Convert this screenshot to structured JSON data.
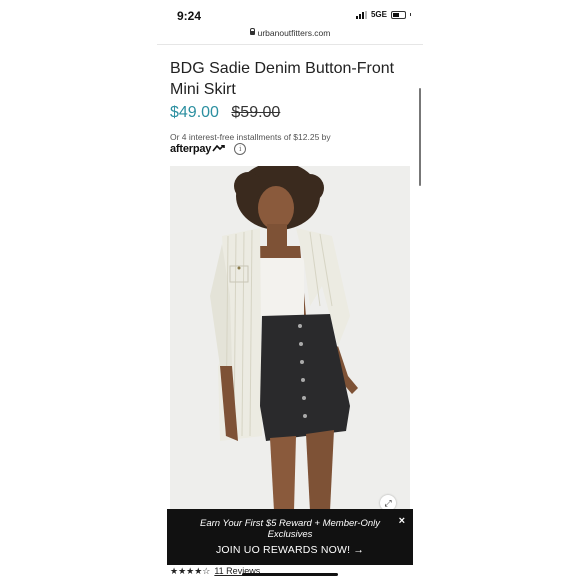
{
  "status_bar": {
    "time": "9:24",
    "network": "5GE"
  },
  "browser": {
    "url": "urbanoutfitters.com"
  },
  "product": {
    "title": "BDG Sadie Denim Button-Front Mini Skirt",
    "sale_price": "$49.00",
    "original_price": "$59.00",
    "installments_text": "Or 4 interest-free installments of $12.25 by",
    "afterpay_logo": "afterpay",
    "info_icon": "i",
    "rating_stars": "★★★★☆",
    "reviews_text": "11 Reviews"
  },
  "banner": {
    "text": "Earn Your First $5 Reward + Member-Only Exclusives",
    "cta": "JOIN UO REWARDS NOW! →",
    "close": "×"
  },
  "icons": {
    "lock": "lock-icon",
    "expand": "expand-icon",
    "close": "close-icon",
    "info": "info-icon"
  },
  "colors": {
    "sale_price": "#2b8fa0",
    "banner_bg": "#111111",
    "image_bg": "#eeeeec",
    "skirt": "#2a2a2c",
    "shirt": "#ecebe2"
  }
}
